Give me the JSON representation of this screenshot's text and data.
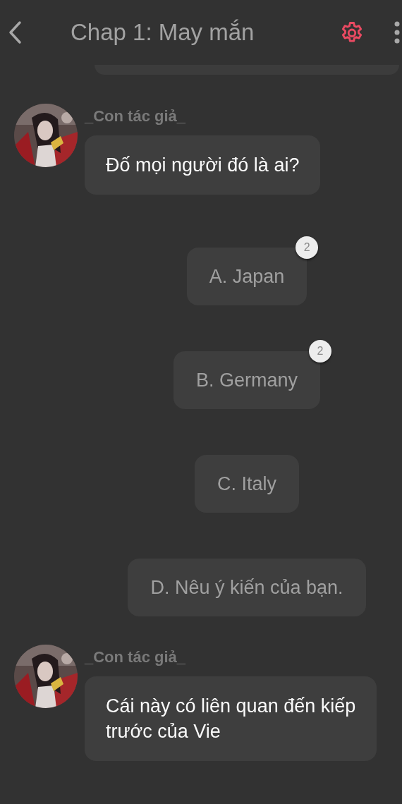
{
  "header": {
    "title": "Chap 1: May mắn"
  },
  "messages": [
    {
      "kind": "text",
      "author": "_Con tác giả_",
      "lines": [
        "Đố mọi người đó là ai?"
      ]
    },
    {
      "kind": "options",
      "options": [
        {
          "label": "A. Japan",
          "votes": "2"
        },
        {
          "label": "B. Germany",
          "votes": "2"
        },
        {
          "label": "C. Italy"
        },
        {
          "label": "D. Nêu ý kiến của bạn."
        }
      ]
    },
    {
      "kind": "text",
      "author": "_Con tác giả_",
      "lines": [
        "Cái này có liên quan đến kiếp",
        "trước của Vie"
      ]
    }
  ]
}
